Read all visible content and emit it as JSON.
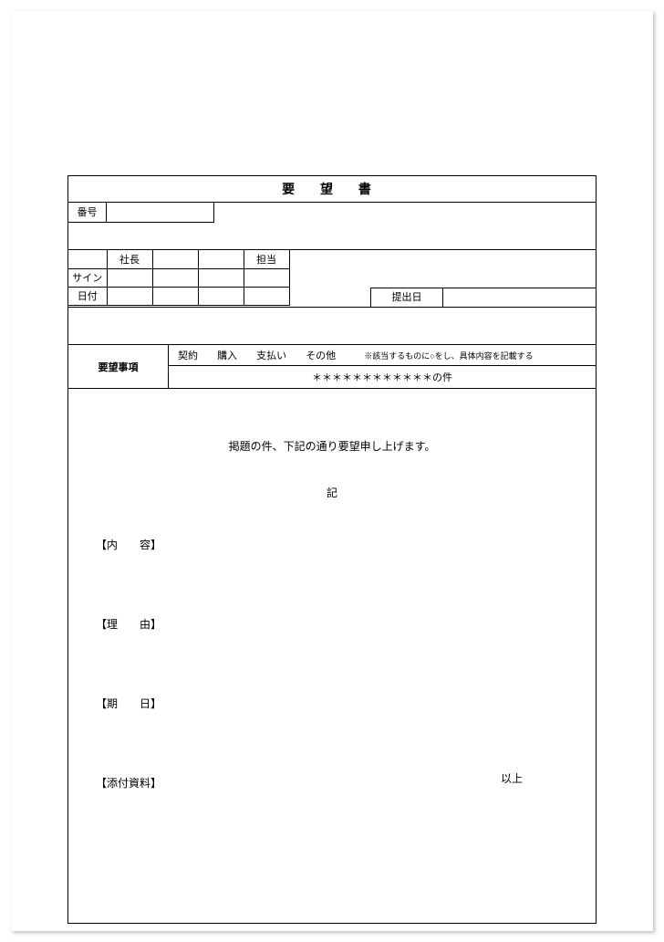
{
  "title": "要 望 書",
  "number_label": "番号",
  "approvals": {
    "col_president": "社長",
    "col_charge": "担当",
    "row_sign": "サイン",
    "row_date": "日付"
  },
  "submit_label": "提出日",
  "request": {
    "label": "要望事項",
    "categories": [
      "契約",
      "購入",
      "支払い",
      "その他"
    ],
    "hint": "※該当するものに○をし、具体内容を記載する",
    "subject": "＊＊＊＊＊＊＊＊＊＊＊＊の件"
  },
  "body": {
    "intro": "掲題の件、下記の通り要望申し上げます。",
    "ki": "記",
    "sections": {
      "content": "【内　　容】",
      "reason": "【理　　由】",
      "deadline": "【期　　日】",
      "attach": "【添付資料】"
    },
    "end": "以上"
  }
}
